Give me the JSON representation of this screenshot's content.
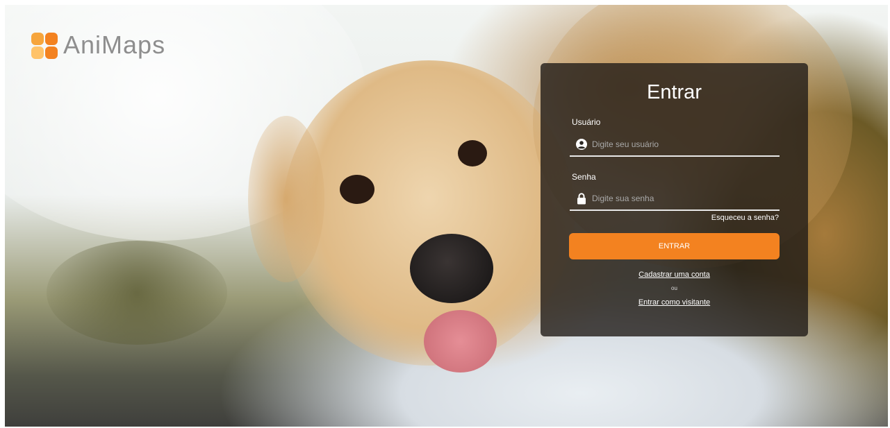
{
  "brand": {
    "name": "AniMaps",
    "colors": [
      "#f38220",
      "#f6a53c",
      "#ffc36a",
      "#8e8e8e"
    ]
  },
  "background": {
    "image": "puppy-held-by-child-photo"
  },
  "login": {
    "title": "Entrar",
    "username_label": "Usuário",
    "username_placeholder": "Digite seu usuário",
    "username_icon": "user-circle-icon",
    "password_label": "Senha",
    "password_placeholder": "Digite sua senha",
    "password_icon": "lock-icon",
    "forgot_link": "Esqueceu a senha?",
    "submit_label": "ENTRAR",
    "register_link": "Cadastrar uma conta",
    "separator": "ou",
    "guest_link": "Entrar como visitante"
  },
  "colors": {
    "accent": "#f38220",
    "panel": "#201c18"
  }
}
